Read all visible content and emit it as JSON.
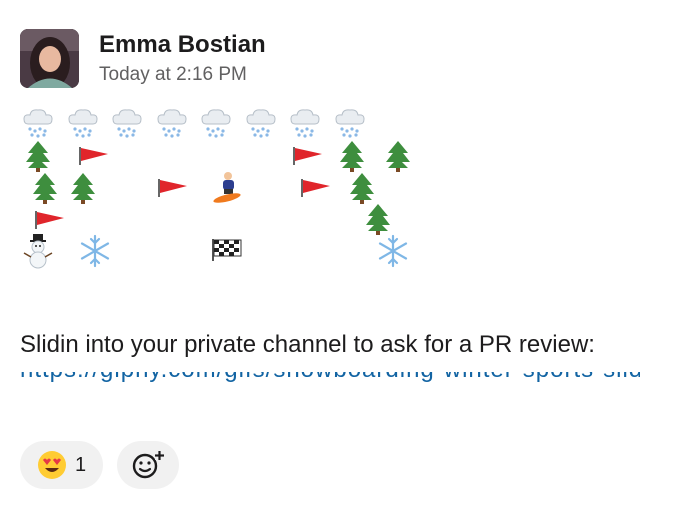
{
  "message": {
    "author": "Emma Bostian",
    "timestamp": "Today at 2:16 PM",
    "text": "Slidin into your private channel to ask for a PR review:",
    "link_partial": "https://giphy.com/gifs/snowboarding-winter-sports-slide"
  },
  "reactions": [
    {
      "emoji": "heart-eyes-emoji",
      "count": "1"
    }
  ],
  "add_reaction": {
    "icon": "add-reaction-icon"
  },
  "emoji_art": {
    "row_weather": "snow-cloud",
    "items": [
      "snow-cloud",
      "evergreen-tree",
      "red-flag",
      "snowboarder",
      "snowman",
      "snowflake",
      "checkered-flag"
    ]
  }
}
